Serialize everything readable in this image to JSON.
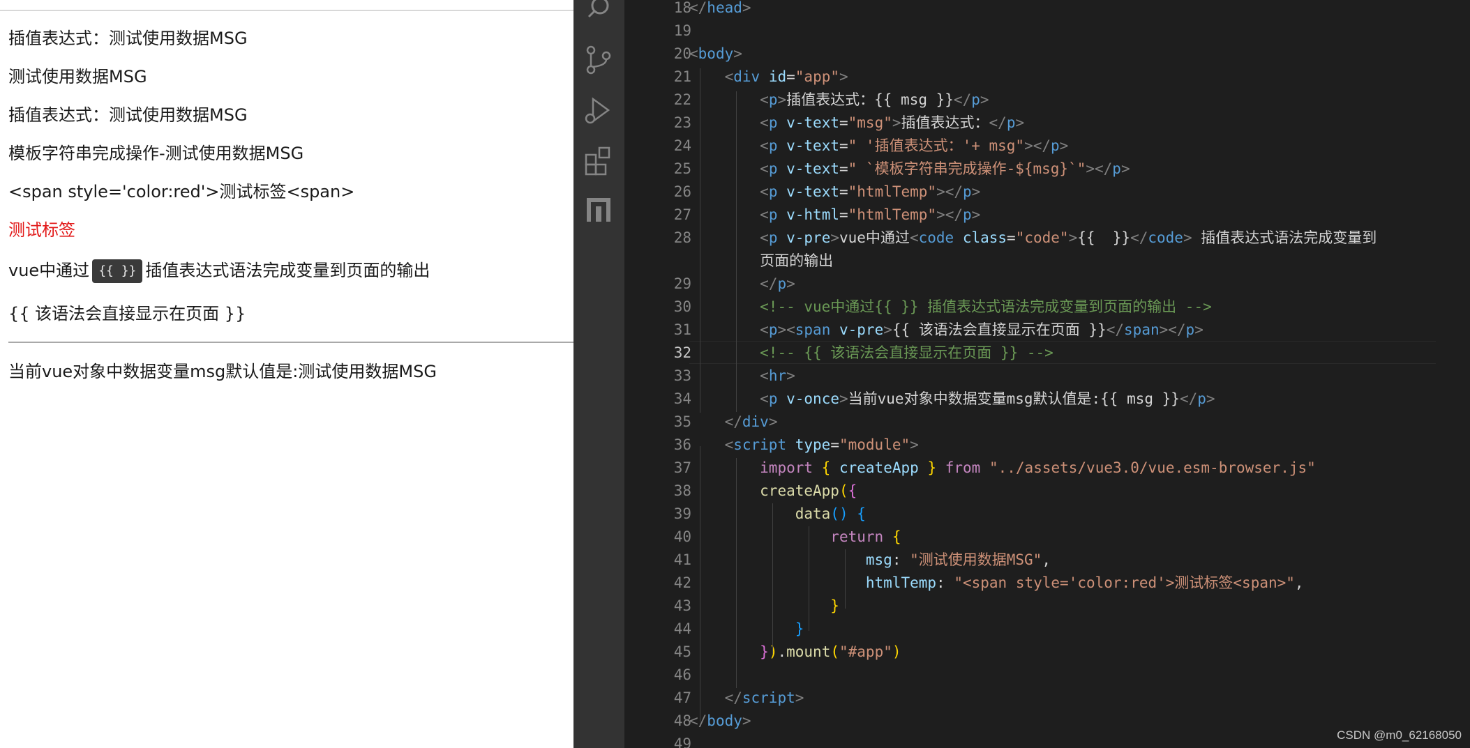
{
  "preview": {
    "lines": [
      "插值表达式：测试使用数据MSG",
      "测试使用数据MSG",
      "插值表达式：测试使用数据MSG",
      "模板字符串完成操作-测试使用数据MSG",
      "<span style='color:red'>测试标签<span>",
      "测试标签"
    ],
    "vpre_prefix": "vue中通过",
    "vpre_code": "{{ }}",
    "vpre_suffix": "插值表达式语法完成变量到页面的输出",
    "raw_mustache": "{{ 该语法会直接显示在页面 }}",
    "once_line": "当前vue对象中数据变量msg默认值是:测试使用数据MSG"
  },
  "editor": {
    "active_line": "32",
    "line_numbers": [
      "18",
      "19",
      "20",
      "21",
      "22",
      "23",
      "24",
      "25",
      "26",
      "27",
      "28",
      "",
      "29",
      "30",
      "31",
      "32",
      "33",
      "34",
      "35",
      "36",
      "37",
      "38",
      "39",
      "40",
      "41",
      "42",
      "43",
      "44",
      "45",
      "46",
      "47",
      "48",
      "49"
    ],
    "code_lines": [
      [
        {
          "c": "t-tag",
          "t": "</"
        },
        {
          "c": "t-el",
          "t": "head"
        },
        {
          "c": "t-tag",
          "t": ">"
        }
      ],
      [],
      [
        {
          "c": "t-tag",
          "t": "<"
        },
        {
          "c": "t-el",
          "t": "body"
        },
        {
          "c": "t-tag",
          "t": ">"
        }
      ],
      [
        {
          "c": "t-text",
          "t": "    "
        },
        {
          "c": "t-tag",
          "t": "<"
        },
        {
          "c": "t-el",
          "t": "div"
        },
        {
          "c": "t-text",
          "t": " "
        },
        {
          "c": "t-attr",
          "t": "id"
        },
        {
          "c": "t-text",
          "t": "="
        },
        {
          "c": "t-str",
          "t": "\"app\""
        },
        {
          "c": "t-tag",
          "t": ">"
        }
      ],
      [
        {
          "c": "t-text",
          "t": "        "
        },
        {
          "c": "t-tag",
          "t": "<"
        },
        {
          "c": "t-el",
          "t": "p"
        },
        {
          "c": "t-tag",
          "t": ">"
        },
        {
          "c": "t-text",
          "t": "插值表达式：{{ msg }}"
        },
        {
          "c": "t-tag",
          "t": "</"
        },
        {
          "c": "t-el",
          "t": "p"
        },
        {
          "c": "t-tag",
          "t": ">"
        }
      ],
      [
        {
          "c": "t-text",
          "t": "        "
        },
        {
          "c": "t-tag",
          "t": "<"
        },
        {
          "c": "t-el",
          "t": "p"
        },
        {
          "c": "t-text",
          "t": " "
        },
        {
          "c": "t-attr",
          "t": "v-text"
        },
        {
          "c": "t-text",
          "t": "="
        },
        {
          "c": "t-str",
          "t": "\"msg\""
        },
        {
          "c": "t-tag",
          "t": ">"
        },
        {
          "c": "t-text",
          "t": "插值表达式："
        },
        {
          "c": "t-tag",
          "t": "</"
        },
        {
          "c": "t-el",
          "t": "p"
        },
        {
          "c": "t-tag",
          "t": ">"
        }
      ],
      [
        {
          "c": "t-text",
          "t": "        "
        },
        {
          "c": "t-tag",
          "t": "<"
        },
        {
          "c": "t-el",
          "t": "p"
        },
        {
          "c": "t-text",
          "t": " "
        },
        {
          "c": "t-attr",
          "t": "v-text"
        },
        {
          "c": "t-text",
          "t": "="
        },
        {
          "c": "t-str",
          "t": "\" '插值表达式：'+ msg\""
        },
        {
          "c": "t-tag",
          "t": "></"
        },
        {
          "c": "t-el",
          "t": "p"
        },
        {
          "c": "t-tag",
          "t": ">"
        }
      ],
      [
        {
          "c": "t-text",
          "t": "        "
        },
        {
          "c": "t-tag",
          "t": "<"
        },
        {
          "c": "t-el",
          "t": "p"
        },
        {
          "c": "t-text",
          "t": " "
        },
        {
          "c": "t-attr",
          "t": "v-text"
        },
        {
          "c": "t-text",
          "t": "="
        },
        {
          "c": "t-str",
          "t": "\" `模板字符串完成操作-${msg}`\""
        },
        {
          "c": "t-tag",
          "t": "></"
        },
        {
          "c": "t-el",
          "t": "p"
        },
        {
          "c": "t-tag",
          "t": ">"
        }
      ],
      [
        {
          "c": "t-text",
          "t": "        "
        },
        {
          "c": "t-tag",
          "t": "<"
        },
        {
          "c": "t-el",
          "t": "p"
        },
        {
          "c": "t-text",
          "t": " "
        },
        {
          "c": "t-attr",
          "t": "v-text"
        },
        {
          "c": "t-text",
          "t": "="
        },
        {
          "c": "t-str",
          "t": "\"htmlTemp\""
        },
        {
          "c": "t-tag",
          "t": "></"
        },
        {
          "c": "t-el",
          "t": "p"
        },
        {
          "c": "t-tag",
          "t": ">"
        }
      ],
      [
        {
          "c": "t-text",
          "t": "        "
        },
        {
          "c": "t-tag",
          "t": "<"
        },
        {
          "c": "t-el",
          "t": "p"
        },
        {
          "c": "t-text",
          "t": " "
        },
        {
          "c": "t-attr",
          "t": "v-html"
        },
        {
          "c": "t-text",
          "t": "="
        },
        {
          "c": "t-str",
          "t": "\"htmlTemp\""
        },
        {
          "c": "t-tag",
          "t": "></"
        },
        {
          "c": "t-el",
          "t": "p"
        },
        {
          "c": "t-tag",
          "t": ">"
        }
      ],
      [
        {
          "c": "t-text",
          "t": "        "
        },
        {
          "c": "t-tag",
          "t": "<"
        },
        {
          "c": "t-el",
          "t": "p"
        },
        {
          "c": "t-text",
          "t": " "
        },
        {
          "c": "t-attr",
          "t": "v-pre"
        },
        {
          "c": "t-tag",
          "t": ">"
        },
        {
          "c": "t-text",
          "t": "vue中通过"
        },
        {
          "c": "t-tag",
          "t": "<"
        },
        {
          "c": "t-el",
          "t": "code"
        },
        {
          "c": "t-text",
          "t": " "
        },
        {
          "c": "t-attr",
          "t": "class"
        },
        {
          "c": "t-text",
          "t": "="
        },
        {
          "c": "t-str",
          "t": "\"code\""
        },
        {
          "c": "t-tag",
          "t": ">"
        },
        {
          "c": "t-text",
          "t": "{{  }}"
        },
        {
          "c": "t-tag",
          "t": "</"
        },
        {
          "c": "t-el",
          "t": "code"
        },
        {
          "c": "t-tag",
          "t": ">"
        },
        {
          "c": "t-text",
          "t": " 插值表达式语法完成变量到"
        }
      ],
      [
        {
          "c": "t-text",
          "t": "        页面的输出"
        }
      ],
      [
        {
          "c": "t-text",
          "t": "        "
        },
        {
          "c": "t-tag",
          "t": "</"
        },
        {
          "c": "t-el",
          "t": "p"
        },
        {
          "c": "t-tag",
          "t": ">"
        }
      ],
      [
        {
          "c": "t-text",
          "t": "        "
        },
        {
          "c": "t-cmt",
          "t": "<!-- vue中通过{{ }} 插值表达式语法完成变量到页面的输出 -->"
        }
      ],
      [
        {
          "c": "t-text",
          "t": "        "
        },
        {
          "c": "t-tag",
          "t": "<"
        },
        {
          "c": "t-el",
          "t": "p"
        },
        {
          "c": "t-tag",
          "t": "><"
        },
        {
          "c": "t-el",
          "t": "span"
        },
        {
          "c": "t-text",
          "t": " "
        },
        {
          "c": "t-attr",
          "t": "v-pre"
        },
        {
          "c": "t-tag",
          "t": ">"
        },
        {
          "c": "t-text",
          "t": "{{ 该语法会直接显示在页面 }}"
        },
        {
          "c": "t-tag",
          "t": "</"
        },
        {
          "c": "t-el",
          "t": "span"
        },
        {
          "c": "t-tag",
          "t": "></"
        },
        {
          "c": "t-el",
          "t": "p"
        },
        {
          "c": "t-tag",
          "t": ">"
        }
      ],
      [
        {
          "c": "t-text",
          "t": "        "
        },
        {
          "c": "t-cmt",
          "t": "<!-- {{ 该语法会直接显示在页面 }} -->"
        }
      ],
      [
        {
          "c": "t-text",
          "t": "        "
        },
        {
          "c": "t-tag",
          "t": "<"
        },
        {
          "c": "t-el",
          "t": "hr"
        },
        {
          "c": "t-tag",
          "t": ">"
        }
      ],
      [
        {
          "c": "t-text",
          "t": "        "
        },
        {
          "c": "t-tag",
          "t": "<"
        },
        {
          "c": "t-el",
          "t": "p"
        },
        {
          "c": "t-text",
          "t": " "
        },
        {
          "c": "t-attr",
          "t": "v-once"
        },
        {
          "c": "t-tag",
          "t": ">"
        },
        {
          "c": "t-text",
          "t": "当前vue对象中数据变量msg默认值是:{{ msg }}"
        },
        {
          "c": "t-tag",
          "t": "</"
        },
        {
          "c": "t-el",
          "t": "p"
        },
        {
          "c": "t-tag",
          "t": ">"
        }
      ],
      [
        {
          "c": "t-text",
          "t": "    "
        },
        {
          "c": "t-tag",
          "t": "</"
        },
        {
          "c": "t-el",
          "t": "div"
        },
        {
          "c": "t-tag",
          "t": ">"
        }
      ],
      [
        {
          "c": "t-text",
          "t": "    "
        },
        {
          "c": "t-tag",
          "t": "<"
        },
        {
          "c": "t-el",
          "t": "script"
        },
        {
          "c": "t-text",
          "t": " "
        },
        {
          "c": "t-attr",
          "t": "type"
        },
        {
          "c": "t-text",
          "t": "="
        },
        {
          "c": "t-str",
          "t": "\"module\""
        },
        {
          "c": "t-tag",
          "t": ">"
        }
      ],
      [
        {
          "c": "t-text",
          "t": "        "
        },
        {
          "c": "t-kw",
          "t": "import"
        },
        {
          "c": "t-text",
          "t": " "
        },
        {
          "c": "t-br1",
          "t": "{"
        },
        {
          "c": "t-text",
          "t": " "
        },
        {
          "c": "t-attr",
          "t": "createApp"
        },
        {
          "c": "t-text",
          "t": " "
        },
        {
          "c": "t-br1",
          "t": "}"
        },
        {
          "c": "t-text",
          "t": " "
        },
        {
          "c": "t-kw",
          "t": "from"
        },
        {
          "c": "t-text",
          "t": " "
        },
        {
          "c": "t-str",
          "t": "\"../assets/vue3.0/vue.esm-browser.js\""
        }
      ],
      [
        {
          "c": "t-text",
          "t": "        "
        },
        {
          "c": "t-fn",
          "t": "createApp"
        },
        {
          "c": "t-br1",
          "t": "("
        },
        {
          "c": "t-br2",
          "t": "{"
        }
      ],
      [
        {
          "c": "t-text",
          "t": "            "
        },
        {
          "c": "t-fn",
          "t": "data"
        },
        {
          "c": "t-br3",
          "t": "()"
        },
        {
          "c": "t-text",
          "t": " "
        },
        {
          "c": "t-br3",
          "t": "{"
        }
      ],
      [
        {
          "c": "t-text",
          "t": "                "
        },
        {
          "c": "t-kw",
          "t": "return"
        },
        {
          "c": "t-text",
          "t": " "
        },
        {
          "c": "t-br1",
          "t": "{"
        }
      ],
      [
        {
          "c": "t-text",
          "t": "                    "
        },
        {
          "c": "t-attr",
          "t": "msg"
        },
        {
          "c": "t-text",
          "t": ": "
        },
        {
          "c": "t-str",
          "t": "\"测试使用数据MSG\""
        },
        {
          "c": "t-text",
          "t": ","
        }
      ],
      [
        {
          "c": "t-text",
          "t": "                    "
        },
        {
          "c": "t-attr",
          "t": "htmlTemp"
        },
        {
          "c": "t-text",
          "t": ": "
        },
        {
          "c": "t-str",
          "t": "\"<span style='color:red'>测试标签<span>\""
        },
        {
          "c": "t-text",
          "t": ","
        }
      ],
      [
        {
          "c": "t-text",
          "t": "                "
        },
        {
          "c": "t-br1",
          "t": "}"
        }
      ],
      [
        {
          "c": "t-text",
          "t": "            "
        },
        {
          "c": "t-br3",
          "t": "}"
        }
      ],
      [
        {
          "c": "t-text",
          "t": "        "
        },
        {
          "c": "t-br2",
          "t": "}"
        },
        {
          "c": "t-br1",
          "t": ")"
        },
        {
          "c": "t-text",
          "t": "."
        },
        {
          "c": "t-fn",
          "t": "mount"
        },
        {
          "c": "t-br1",
          "t": "("
        },
        {
          "c": "t-str",
          "t": "\"#app\""
        },
        {
          "c": "t-br1",
          "t": ")"
        }
      ],
      [],
      [
        {
          "c": "t-text",
          "t": "    "
        },
        {
          "c": "t-tag",
          "t": "</"
        },
        {
          "c": "t-el",
          "t": "script"
        },
        {
          "c": "t-tag",
          "t": ">"
        }
      ],
      [
        {
          "c": "t-tag",
          "t": "</"
        },
        {
          "c": "t-el",
          "t": "body"
        },
        {
          "c": "t-tag",
          "t": ">"
        }
      ],
      []
    ]
  },
  "activity_bar": [
    "search-icon",
    "source-control-icon",
    "run-debug-icon",
    "extensions-icon",
    "remote-explorer-icon"
  ],
  "watermark": "CSDN @m0_62168050"
}
